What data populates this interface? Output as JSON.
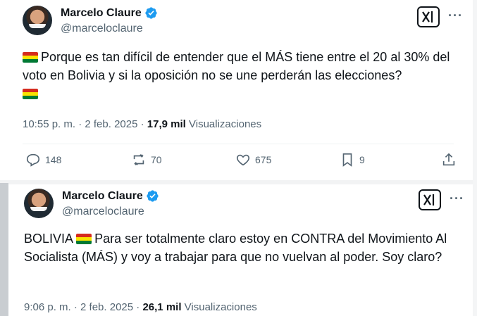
{
  "tweets": [
    {
      "author_name": "Marcelo Claure",
      "handle": "@marceloclaure",
      "text": "Porque es tan difícil de entender que el MÁS tiene entre el 20 al 30% del voto en Bolivia y si la oposición no se une perderán las elecciones?",
      "time": "10:55 p. m. · 2 feb. 2025",
      "dot": "·",
      "views_count": "17,9 mil",
      "views_label": "Visualizaciones",
      "actions": {
        "replies": "148",
        "reposts": "70",
        "likes": "675",
        "bookmarks": "9"
      }
    },
    {
      "author_name": "Marcelo Claure",
      "handle": "@marceloclaure",
      "text_prefix": "BOLIVIA",
      "text": "Para ser totalmente claro estoy en CONTRA del Movimiento Al Socialista (MÁS) y voy a trabajar para que no vuelvan al poder. Soy claro?",
      "time": "9:06 p. m. · 2 feb. 2025",
      "dot": "·",
      "views_count": "26,1 mil",
      "views_label": "Visualizaciones"
    }
  ],
  "colors": {
    "text": "#0f1419",
    "secondary": "#536471",
    "verified": "#1d9bf0",
    "divider": "#eff3f4"
  },
  "icons": [
    "verified-badge-icon",
    "grok-icon",
    "more-icon",
    "reply-icon",
    "repost-icon",
    "like-icon",
    "bookmark-icon",
    "share-icon",
    "bolivia-flag-icon"
  ]
}
